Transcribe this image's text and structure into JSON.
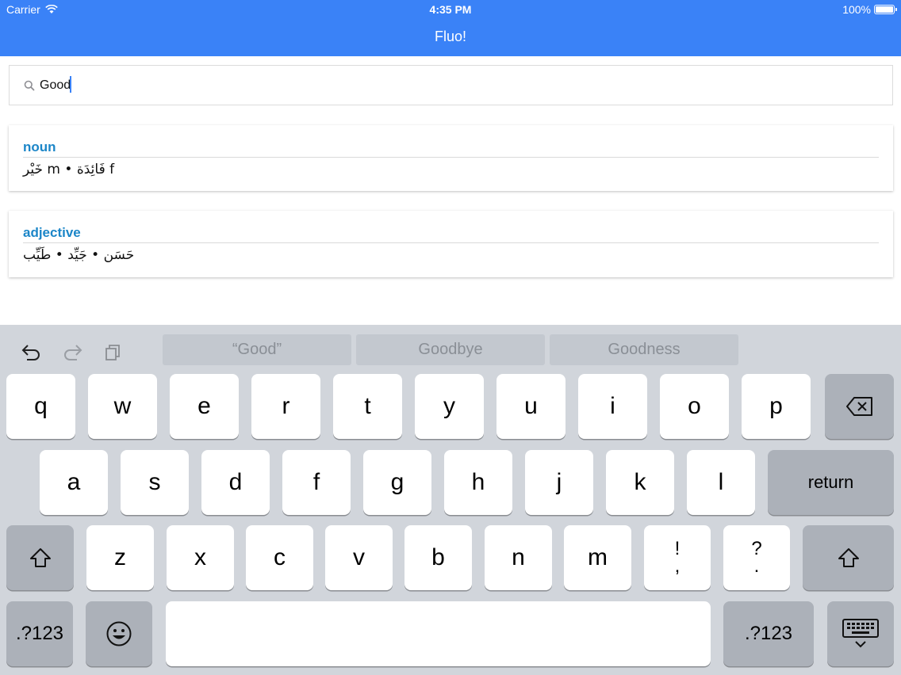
{
  "status": {
    "carrier": "Carrier",
    "time": "4:35 PM",
    "battery": "100%"
  },
  "nav": {
    "title": "Fluo!"
  },
  "search": {
    "value": "Good",
    "icon": "search-icon"
  },
  "results": [
    {
      "pos": "noun",
      "words": "خَيْر m • فَائِدَة f"
    },
    {
      "pos": "adjective",
      "words": "حَسَن • جَيِّد • طَيِّب"
    }
  ],
  "keyboard": {
    "suggestions": [
      "“Good”",
      "Goodbye",
      "Goodness"
    ],
    "row1": [
      "q",
      "w",
      "e",
      "r",
      "t",
      "y",
      "u",
      "i",
      "o",
      "p"
    ],
    "row2": [
      "a",
      "s",
      "d",
      "f",
      "g",
      "h",
      "j",
      "k",
      "l"
    ],
    "row3": [
      "z",
      "x",
      "c",
      "v",
      "b",
      "n",
      "m"
    ],
    "punct1": {
      "top": "!",
      "bottom": ","
    },
    "punct2": {
      "top": "?",
      "bottom": "."
    },
    "return_label": "return",
    "numbers_label": ".?123"
  },
  "colors": {
    "accent": "#3a82f7",
    "pos": "#1c86c8",
    "keyboard_bg": "#d1d5db"
  }
}
